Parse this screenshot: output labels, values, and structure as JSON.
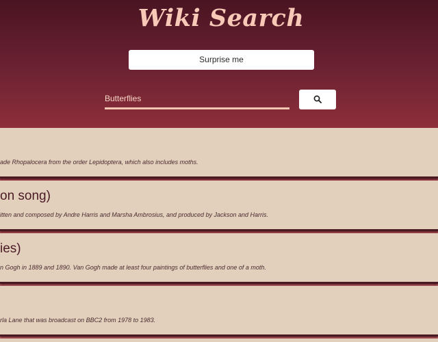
{
  "header": {
    "title": "Wiki Search",
    "surprise_label": "Surprise me"
  },
  "search": {
    "value": "Butterflies",
    "button_icon": "search-icon"
  },
  "results": [
    {
      "title": "",
      "snippet": "ade Rhopalocera from the order Lepidoptera, which also includes moths."
    },
    {
      "title": "on song)",
      "snippet": "itten and composed by Andre Harris and Marsha Ambrosius, and produced by Jackson and Harris."
    },
    {
      "title": "ies)",
      "snippet": "n Gogh in 1889 and 1890. Van Gogh made at least four paintings of butterflies and one of a moth."
    },
    {
      "title": "",
      "snippet": "rla Lane that was broadcast on BBC2 from 1978 to 1983."
    }
  ],
  "colors": {
    "background_top": "#4a1422",
    "background_bottom": "#c87070",
    "title": "#f8c9b7",
    "card": "#e2d0bd",
    "card_text": "#4a1a24"
  }
}
